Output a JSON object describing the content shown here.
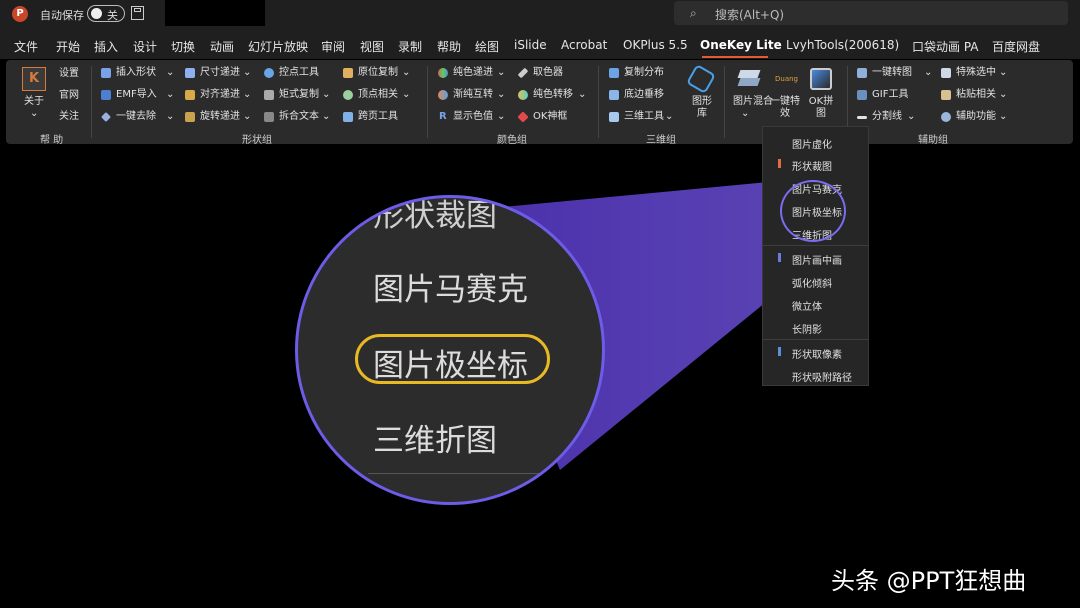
{
  "titlebar": {
    "autosave_label": "自动保存",
    "autosave_state": "关",
    "search_placeholder": "搜索(Alt+Q)"
  },
  "menu": {
    "items": [
      "文件",
      "开始",
      "插入",
      "设计",
      "切换",
      "动画",
      "幻灯片放映",
      "审阅",
      "视图",
      "录制",
      "帮助",
      "绘图",
      "iSlide",
      "Acrobat",
      "OKPlus 5.5",
      "OneKey Lite",
      "LvyhTools(200618)",
      "口袋动画 PA",
      "百度网盘"
    ],
    "active_index": 15,
    "accent_color": "#e25b35"
  },
  "ribbon": {
    "help_group": {
      "about_label": "关于",
      "about_arrow": "⌄",
      "settings_label": "设置",
      "website_label": "官网",
      "follow_label": "关注",
      "group_label": "帮 助"
    },
    "shape_group": {
      "col1": [
        "插入形状",
        "EMF导入",
        "一键去除"
      ],
      "col2": [
        "尺寸递进",
        "对齐递进",
        "旋转递进"
      ],
      "col3": [
        "控点工具",
        "矩式复制",
        "拆合文本"
      ],
      "col4": [
        "原位复制",
        "顶点相关",
        "跨页工具"
      ],
      "group_label": "形状组"
    },
    "color_group": {
      "col1": [
        "纯色递进",
        "渐纯互转",
        "显示色值"
      ],
      "col2": [
        "取色器",
        "纯色转移",
        "OK神框"
      ],
      "group_label": "颜色组"
    },
    "3d_group": {
      "col1": [
        "复制分布",
        "底边垂移",
        "三维工具"
      ],
      "shape_lib_label": "图形库",
      "group_label": "三维组"
    },
    "image_group": {
      "image_mix_label": "图片混合",
      "one_click_effect_label": "一键特效",
      "ok_collage_label": "OK拼图",
      "duang_label": "Duang"
    },
    "aux_group": {
      "col1": [
        "一键转图",
        "GIF工具",
        "分割线"
      ],
      "col2": [
        "特殊选中",
        "粘贴相关",
        "辅助功能"
      ],
      "group_label": "辅助组"
    }
  },
  "dropdown": {
    "items": [
      "图片虚化",
      "形状裁图",
      "图片马赛克",
      "图片极坐标",
      "三维折图",
      "图片画中画",
      "弧化倾斜",
      "微立体",
      "长阴影",
      "形状取像素",
      "形状吸附路径"
    ],
    "selected_index": 3,
    "highlight_color": "#6c5ce7",
    "mark_colors": [
      "#e06b4a",
      "#6b7bd8",
      "#5b8fd8"
    ]
  },
  "magnifier": {
    "top_partial": "形状裁图",
    "line1": "图片马赛克",
    "line2": "图片极坐标",
    "line3": "三维折图",
    "ring_color": "#e8b923"
  },
  "watermark": {
    "text": "头条 @PPT狂想曲"
  }
}
